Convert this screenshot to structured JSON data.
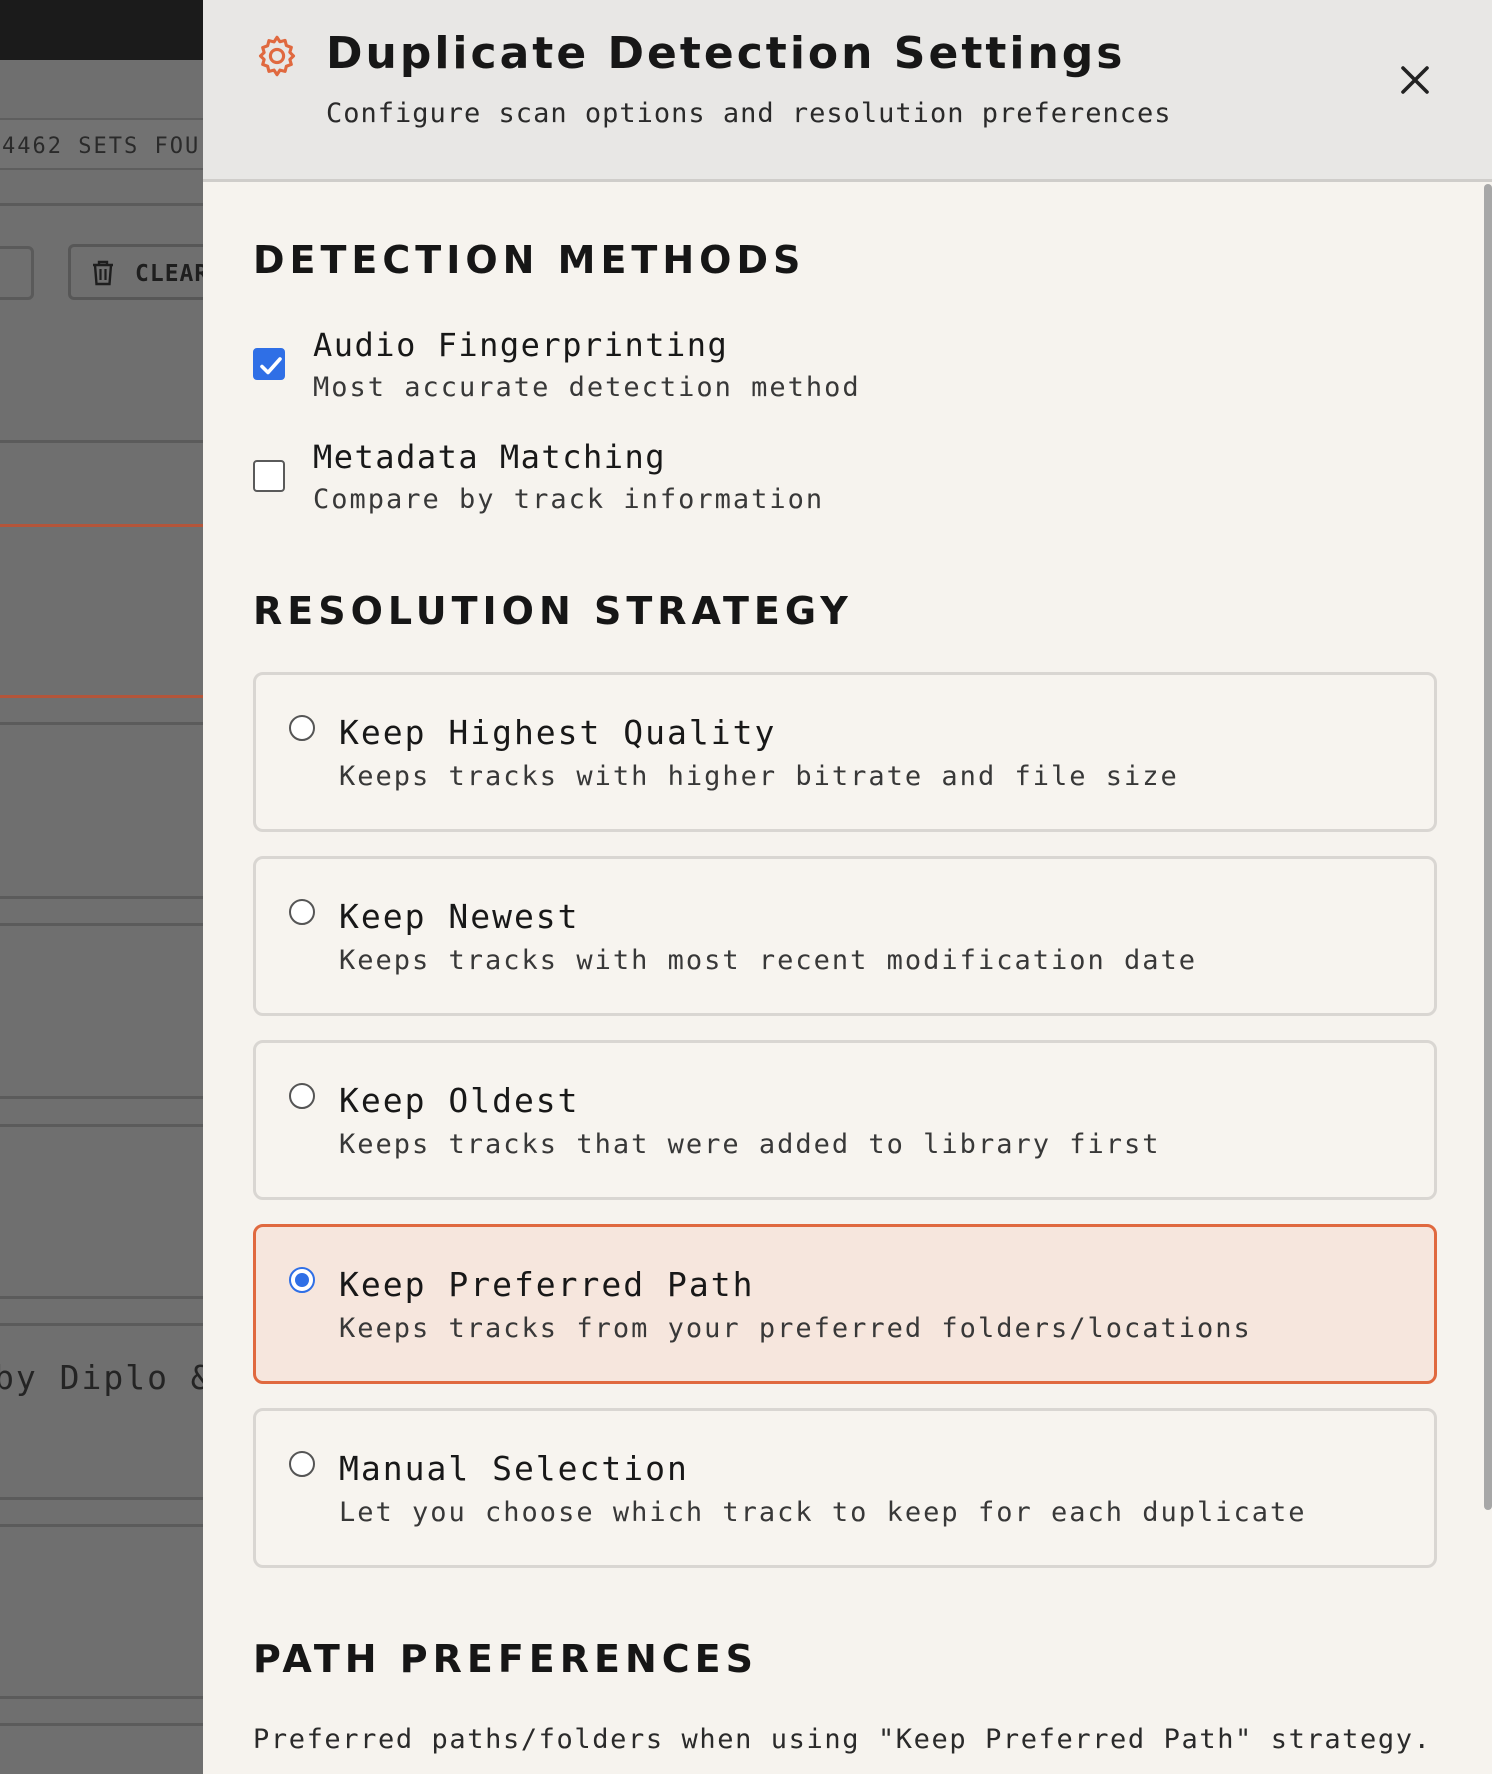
{
  "background": {
    "sets_found_text": "4462 SETS FOU",
    "clear_label": "CLEAR",
    "artist_text": "by Diplo &"
  },
  "panel": {
    "title": "Duplicate Detection Settings",
    "subtitle": "Configure scan options and resolution preferences",
    "close_icon": "close-icon",
    "header_icon": "gear-icon",
    "accent_color": "#e0693f"
  },
  "detection_methods": {
    "title": "DETECTION METHODS",
    "options": [
      {
        "label": "Audio Fingerprinting",
        "description": "Most accurate detection method",
        "checked": true
      },
      {
        "label": "Metadata Matching",
        "description": "Compare by track information",
        "checked": false
      }
    ]
  },
  "resolution_strategy": {
    "title": "RESOLUTION STRATEGY",
    "selected": "Keep Preferred Path",
    "options": [
      {
        "label": "Keep Highest Quality",
        "description": "Keeps tracks with higher bitrate and file size"
      },
      {
        "label": "Keep Newest",
        "description": "Keeps tracks with most recent modification date"
      },
      {
        "label": "Keep Oldest",
        "description": "Keeps tracks that were added to library first"
      },
      {
        "label": "Keep Preferred Path",
        "description": "Keeps tracks from your preferred folders/locations"
      },
      {
        "label": "Manual Selection",
        "description": "Let you choose which track to keep for each duplicate"
      }
    ]
  },
  "path_preferences": {
    "title": "PATH PREFERENCES",
    "description": "Preferred paths/folders when using \"Keep Preferred Path\" strategy."
  }
}
